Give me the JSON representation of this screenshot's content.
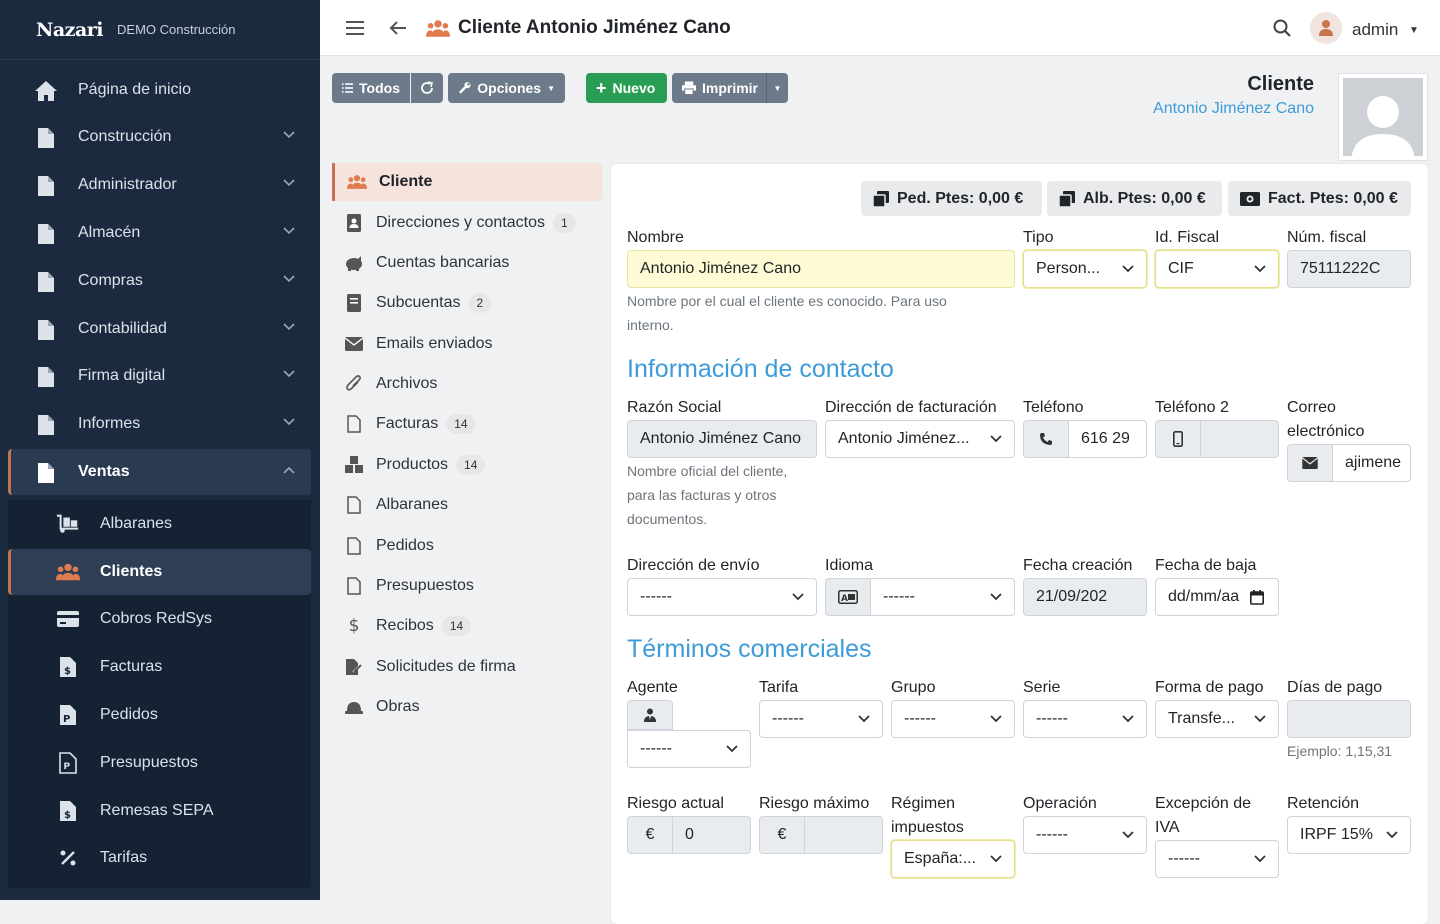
{
  "sidebar": {
    "brand": "Nazari",
    "company": "DEMO Construcción",
    "items": [
      {
        "label": "Página de inicio",
        "icon": "home-icon"
      },
      {
        "label": "Construcción",
        "icon": "file-icon"
      },
      {
        "label": "Administrador",
        "icon": "file-icon"
      },
      {
        "label": "Almacén",
        "icon": "file-icon"
      },
      {
        "label": "Compras",
        "icon": "file-icon"
      },
      {
        "label": "Contabilidad",
        "icon": "file-icon"
      },
      {
        "label": "Firma digital",
        "icon": "file-icon"
      },
      {
        "label": "Informes",
        "icon": "file-icon"
      },
      {
        "label": "Ventas",
        "icon": "file-icon"
      }
    ],
    "sub_items": [
      {
        "label": "Albaranes",
        "icon": "dolly-icon"
      },
      {
        "label": "Clientes",
        "icon": "users-icon"
      },
      {
        "label": "Cobros RedSys",
        "icon": "credit-card-icon"
      },
      {
        "label": "Facturas",
        "icon": "invoice-dollar-icon"
      },
      {
        "label": "Pedidos",
        "icon": "file-p-icon"
      },
      {
        "label": "Presupuestos",
        "icon": "file-p-icon"
      },
      {
        "label": "Remesas SEPA",
        "icon": "invoice-dollar-icon"
      },
      {
        "label": "Tarifas",
        "icon": "percent-icon"
      }
    ]
  },
  "topbar": {
    "title": "Cliente Antonio Jiménez Cano",
    "user": "admin"
  },
  "toolbar": {
    "all": "Todos",
    "options": "Opciones",
    "new": "Nuevo",
    "print": "Imprimir"
  },
  "header": {
    "entity_type": "Cliente",
    "entity_name": "Antonio Jiménez Cano"
  },
  "tabs": [
    {
      "label": "Cliente",
      "icon": "users-icon",
      "badge": ""
    },
    {
      "label": "Direcciones y contactos",
      "icon": "address-book-icon",
      "badge": "1"
    },
    {
      "label": "Cuentas bancarias",
      "icon": "piggy-bank-icon",
      "badge": ""
    },
    {
      "label": "Subcuentas",
      "icon": "book-icon",
      "badge": "2"
    },
    {
      "label": "Emails enviados",
      "icon": "envelope-icon",
      "badge": ""
    },
    {
      "label": "Archivos",
      "icon": "paperclip-icon",
      "badge": ""
    },
    {
      "label": "Facturas",
      "icon": "file-icon",
      "badge": "14"
    },
    {
      "label": "Productos",
      "icon": "cubes-icon",
      "badge": "14"
    },
    {
      "label": "Albaranes",
      "icon": "file-icon",
      "badge": ""
    },
    {
      "label": "Pedidos",
      "icon": "file-icon",
      "badge": ""
    },
    {
      "label": "Presupuestos",
      "icon": "file-icon",
      "badge": ""
    },
    {
      "label": "Recibos",
      "icon": "dollar-icon",
      "badge": "14"
    },
    {
      "label": "Solicitudes de firma",
      "icon": "file-signature-icon",
      "badge": ""
    },
    {
      "label": "Obras",
      "icon": "hard-hat-icon",
      "badge": ""
    }
  ],
  "pending": {
    "orders": "Ped. Ptes: 0,00 €",
    "delivery": "Alb. Ptes: 0,00 €",
    "invoices": "Fact. Ptes: 0,00 €"
  },
  "form": {
    "nombre_label": "Nombre",
    "nombre_value": "Antonio Jiménez Cano",
    "nombre_help": "Nombre por el cual el cliente es conocido. Para uso interno.",
    "tipo_label": "Tipo",
    "tipo_value": "Person...",
    "idfiscal_label": "Id. Fiscal",
    "idfiscal_value": "CIF",
    "numfiscal_label": "Núm. fiscal",
    "numfiscal_value": "75111222C",
    "contact_section": "Información de contacto",
    "razon_label": "Razón Social",
    "razon_value": "Antonio Jiménez Cano",
    "razon_help": "Nombre oficial del cliente, para las facturas y otros documentos.",
    "dirfact_label": "Dirección de facturación",
    "dirfact_value": "Antonio Jiménez...",
    "telefono_label": "Teléfono",
    "telefono_value": "616 29",
    "telefono2_label": "Teléfono 2",
    "telefono2_value": "",
    "correo_label": "Correo electrónico",
    "correo_value": "ajimene",
    "direnvio_label": "Dirección de envío",
    "direnvio_value": "------",
    "idioma_label": "Idioma",
    "idioma_value": "------",
    "fechacre_label": "Fecha creación",
    "fechacre_value": "21/09/202",
    "fechabaja_label": "Fecha de baja",
    "fechabaja_value": "dd/mm/aa",
    "terms_section": "Términos comerciales",
    "agente_label": "Agente",
    "agente_value": "------",
    "tarifa_label": "Tarifa",
    "tarifa_value": "------",
    "grupo_label": "Grupo",
    "grupo_value": "------",
    "serie_label": "Serie",
    "serie_value": "------",
    "formapago_label": "Forma de pago",
    "formapago_value": "Transfe...",
    "diaspago_label": "Días de pago",
    "diaspago_value": "",
    "diaspago_help": "Ejemplo: 1,15,31",
    "riesgoact_label": "Riesgo actual",
    "riesgoact_value": "0",
    "riesgomax_label": "Riesgo máximo",
    "riesgomax_value": "",
    "currency_symbol": "€",
    "regimen_label": "Régimen impuestos",
    "regimen_value": "España:...",
    "operacion_label": "Operación",
    "operacion_value": "------",
    "excepcion_label": "Excepción de IVA",
    "excepcion_value": "------",
    "retencion_label": "Retención",
    "retencion_value": "IRPF 15%"
  },
  "colors": {
    "sidebar_bg": "#1b2a3e",
    "accent": "#c8734f",
    "link": "#3d9bd9",
    "green": "#2a9d55"
  }
}
